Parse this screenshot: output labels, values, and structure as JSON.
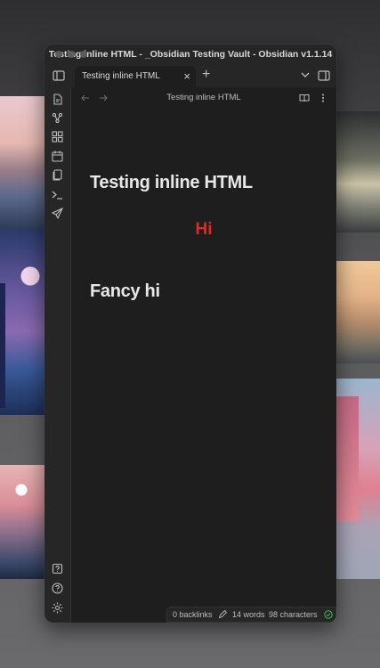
{
  "window": {
    "title": "Testing inline HTML - _Obsidian Testing Vault - Obsidian v1.1.14"
  },
  "tab": {
    "label": "Testing inline HTML",
    "close_glyph": "×",
    "new_tab_glyph": "+"
  },
  "view_header": {
    "title": "Testing inline HTML"
  },
  "note": {
    "heading": "Testing inline HTML",
    "centered_text": "Hi",
    "subheading": "Fancy hi"
  },
  "status_bar": {
    "backlinks": "0 backlinks",
    "words": "14 words",
    "characters": "98 characters"
  },
  "colors": {
    "accent_red": "#e8261c",
    "sync_ok_green": "#3fb950"
  },
  "icons": {
    "ribbon": [
      "open-quick-switcher-icon",
      "graph-view-icon",
      "canvas-icon",
      "daily-note-icon",
      "templates-icon",
      "command-palette-icon",
      "publish-icon"
    ],
    "ribbon_bottom": [
      "help-vault-icon",
      "help-icon",
      "settings-icon"
    ]
  }
}
